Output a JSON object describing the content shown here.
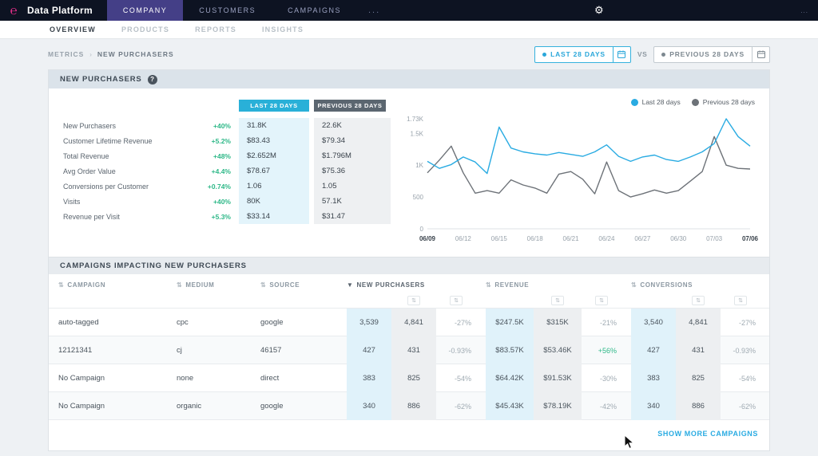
{
  "app": {
    "logo_glyph": "℮",
    "title": "Data Platform",
    "nav": [
      {
        "label": "Company"
      },
      {
        "label": "Customers"
      },
      {
        "label": "Campaigns"
      }
    ],
    "overflow": "...",
    "menu_dots": "..."
  },
  "subnav": [
    {
      "label": "OVERVIEW"
    },
    {
      "label": "PRODUCTS"
    },
    {
      "label": "REPORTS"
    },
    {
      "label": "INSIGHTS"
    }
  ],
  "breadcrumb": {
    "parent": "METRICS",
    "sep": "›",
    "current": "NEW PURCHASERS"
  },
  "date_controls": {
    "primary": "LAST 28 DAYS",
    "vs": "VS",
    "secondary": "PREVIOUS 28 DAYS"
  },
  "metrics_card": {
    "title": "NEW PURCHASERS",
    "help": "?",
    "col_current": "LAST 28 DAYS",
    "col_previous": "PREVIOUS 28 DAYS",
    "rows": [
      {
        "label": "New Purchasers",
        "change": "+40%",
        "current": "31.8K",
        "previous": "22.6K"
      },
      {
        "label": "Customer Lifetime Revenue",
        "change": "+5.2%",
        "current": "$83.43",
        "previous": "$79.34"
      },
      {
        "label": "Total Revenue",
        "change": "+48%",
        "current": "$2.652M",
        "previous": "$1.796M"
      },
      {
        "label": "Avg Order Value",
        "change": "+4.4%",
        "current": "$78.67",
        "previous": "$75.36"
      },
      {
        "label": "Conversions per Customer",
        "change": "+0.74%",
        "current": "1.06",
        "previous": "1.05"
      },
      {
        "label": "Visits",
        "change": "+40%",
        "current": "80K",
        "previous": "57.1K"
      },
      {
        "label": "Revenue per Visit",
        "change": "+5.3%",
        "current": "$33.14",
        "previous": "$31.47"
      }
    ]
  },
  "chart_data": {
    "type": "line",
    "title": "New Purchasers daily trend",
    "x_ticks": [
      "06/09",
      "06/12",
      "06/15",
      "06/18",
      "06/21",
      "06/24",
      "06/27",
      "06/30",
      "07/03",
      "07/06"
    ],
    "x_tick_step": 3,
    "y_ticks": [
      "0",
      "500",
      "1K",
      "1.5K",
      "1.73K"
    ],
    "y_tick_values": [
      0,
      500,
      1000,
      1500,
      1730
    ],
    "ylim": [
      0,
      1730
    ],
    "legend_position": "top-right",
    "grid": false,
    "series": [
      {
        "name": "Last 28 days",
        "color": "#29abe2",
        "values": [
          1060,
          950,
          1010,
          1130,
          1050,
          870,
          1600,
          1270,
          1210,
          1180,
          1160,
          1200,
          1170,
          1140,
          1210,
          1320,
          1140,
          1060,
          1130,
          1160,
          1090,
          1060,
          1130,
          1210,
          1340,
          1730,
          1450,
          1300
        ]
      },
      {
        "name": "Previous 28 days",
        "color": "#6d7278",
        "values": [
          880,
          1080,
          1300,
          880,
          560,
          600,
          560,
          770,
          690,
          640,
          560,
          860,
          900,
          780,
          550,
          1050,
          600,
          500,
          550,
          610,
          560,
          600,
          750,
          900,
          1450,
          1000,
          950,
          940
        ]
      }
    ]
  },
  "campaigns_table": {
    "title": "CAMPAIGNS IMPACTING NEW PURCHASERS",
    "sort_icon": "⇅",
    "sorted_icon": "▼",
    "columns": {
      "campaign": "CAMPAIGN",
      "medium": "MEDIUM",
      "source": "SOURCE",
      "new_purchasers": "NEW PURCHASERS",
      "revenue": "REVENUE",
      "conversions": "CONVERSIONS"
    },
    "rows": [
      {
        "campaign": "auto-tagged",
        "medium": "cpc",
        "source": "google",
        "np": {
          "current": "3,539",
          "previous": "4,841",
          "change": "-27%"
        },
        "rev": {
          "current": "$247.5K",
          "previous": "$315K",
          "change": "-21%"
        },
        "conv": {
          "current": "3,540",
          "previous": "4,841",
          "change": "-27%"
        }
      },
      {
        "campaign": "12121341",
        "medium": "cj",
        "source": "46157",
        "np": {
          "current": "427",
          "previous": "431",
          "change": "-0.93%"
        },
        "rev": {
          "current": "$83.57K",
          "previous": "$53.46K",
          "change": "+56%"
        },
        "conv": {
          "current": "427",
          "previous": "431",
          "change": "-0.93%"
        }
      },
      {
        "campaign": "No Campaign",
        "medium": "none",
        "source": "direct",
        "np": {
          "current": "383",
          "previous": "825",
          "change": "-54%"
        },
        "rev": {
          "current": "$64.42K",
          "previous": "$91.53K",
          "change": "-30%"
        },
        "conv": {
          "current": "383",
          "previous": "825",
          "change": "-54%"
        }
      },
      {
        "campaign": "No Campaign",
        "medium": "organic",
        "source": "google",
        "np": {
          "current": "340",
          "previous": "886",
          "change": "-62%"
        },
        "rev": {
          "current": "$45.43K",
          "previous": "$78.19K",
          "change": "-42%"
        },
        "conv": {
          "current": "340",
          "previous": "886",
          "change": "-62%"
        }
      }
    ],
    "show_more": "SHOW MORE CAMPAIGNS"
  }
}
